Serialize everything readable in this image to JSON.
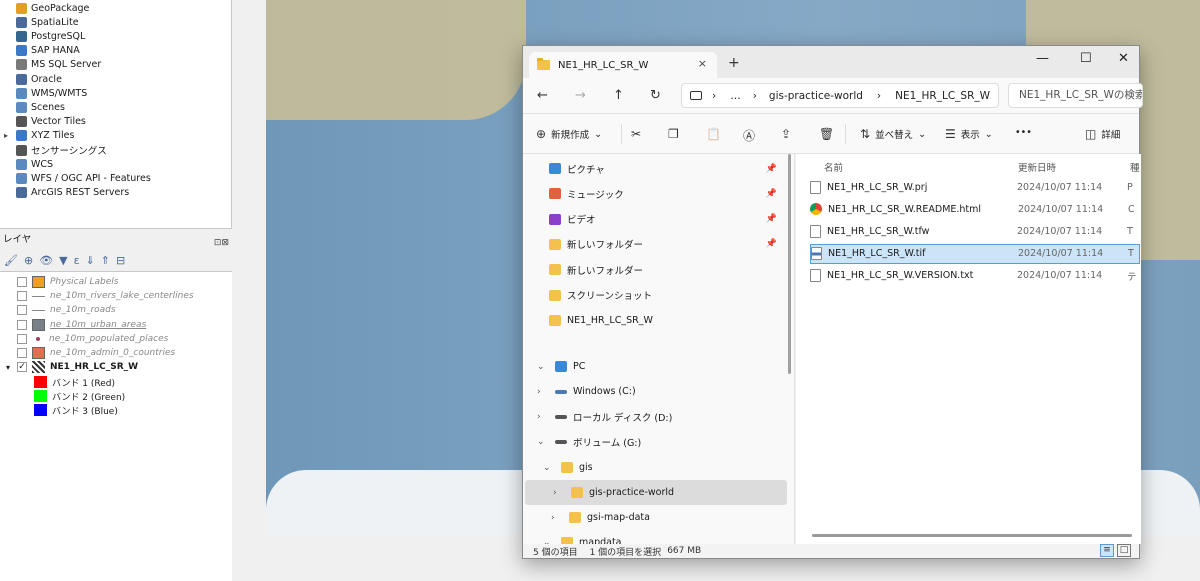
{
  "browser": {
    "items": [
      {
        "label": "GeoPackage",
        "icon": "geopackage-icon",
        "color": "#e0a020"
      },
      {
        "label": "SpatiaLite",
        "icon": "feather-icon",
        "color": "#4a6a9a"
      },
      {
        "label": "PostgreSQL",
        "icon": "elephant-icon",
        "color": "#336791"
      },
      {
        "label": "SAP HANA",
        "icon": "grid-icon",
        "color": "#3a78c8"
      },
      {
        "label": "MS SQL Server",
        "icon": "mssql-icon",
        "color": "#7a7a7a"
      },
      {
        "label": "Oracle",
        "icon": "oracle-icon",
        "color": "#4a6a9a"
      },
      {
        "label": "WMS/WMTS",
        "icon": "globe-icon",
        "color": "#5a8ac0"
      },
      {
        "label": "Scenes",
        "icon": "globe-icon",
        "color": "#5a8ac0"
      },
      {
        "label": "Vector Tiles",
        "icon": "tiles-icon",
        "color": "#555555"
      },
      {
        "label": "XYZ Tiles",
        "icon": "tiles-icon",
        "color": "#3a78c8"
      },
      {
        "label": "センサーシングス",
        "icon": "sensor-icon",
        "color": "#555555"
      },
      {
        "label": "WCS",
        "icon": "globe-icon",
        "color": "#5a8ac0"
      },
      {
        "label": "WFS / OGC API - Features",
        "icon": "globe-icon",
        "color": "#5a8ac0"
      },
      {
        "label": "ArcGIS REST Servers",
        "icon": "arcgis-icon",
        "color": "#4a6a9a"
      }
    ]
  },
  "layers_panel": {
    "title": "レイヤ",
    "buttons": "⊡⊠"
  },
  "layers": [
    {
      "name": "Physical Labels",
      "checked": "",
      "sym_color": "#f0a020",
      "style": "italic"
    },
    {
      "name": "ne_10m_rivers_lake_centerlines",
      "checked": "",
      "sym_color": "#888888",
      "style": "italic"
    },
    {
      "name": "ne_10m_roads",
      "checked": "",
      "sym_color": "#888888",
      "style": "italic"
    },
    {
      "name": "ne_10m_urban_areas",
      "checked": "",
      "sym_color": "#7a8088",
      "style": "italic"
    },
    {
      "name": "ne_10m_populated_places",
      "checked": "",
      "sym_color": "#a04060",
      "style": "italic"
    },
    {
      "name": "ne_10m_admin_0_countries",
      "checked": "",
      "sym_color": "#e07050",
      "style": "italic"
    },
    {
      "name": "NE1_HR_LC_SR_W",
      "checked": "✓",
      "sym_color": "#333333",
      "style": "bold"
    }
  ],
  "bands": [
    {
      "label": "バンド 1 (Red)",
      "color": "#ff0000"
    },
    {
      "label": "バンド 2 (Green)",
      "color": "#00ff00"
    },
    {
      "label": "バンド 3 (Blue)",
      "color": "#0000ff"
    }
  ],
  "explorer": {
    "tab_title": "NE1_HR_LC_SR_W",
    "tab_close": "×",
    "new_tab": "+",
    "window_buttons": [
      "—",
      "☐",
      "✕"
    ],
    "nav": {
      "back": "←",
      "forward": "→",
      "up": "↑",
      "refresh": "↻"
    },
    "address": {
      "more": "…",
      "segments": [
        "gis-practice-world",
        "NE1_HR_LC_SR_W"
      ]
    },
    "search_placeholder": "NE1_HR_LC_SR_Wの検索",
    "commands": {
      "new": "新規作成",
      "sort": "並べ替え",
      "view": "表示",
      "more": "•••",
      "details": "詳細"
    },
    "nav_pane": [
      {
        "label": "ピクチャ",
        "icon": "pictures-icon",
        "color": "#3a88d8",
        "pinned": true
      },
      {
        "label": "ミュージック",
        "icon": "music-icon",
        "color": "#e06040",
        "pinned": true
      },
      {
        "label": "ビデオ",
        "icon": "video-icon",
        "color": "#8a40c8",
        "pinned": true
      },
      {
        "label": "新しいフォルダー",
        "icon": "folder-icon",
        "color": "#f3c24c",
        "pinned": true
      },
      {
        "label": "新しいフォルダー",
        "icon": "folder-icon",
        "color": "#f3c24c",
        "pinned": false
      },
      {
        "label": "スクリーンショット",
        "icon": "folder-icon",
        "color": "#f3c24c",
        "pinned": false
      },
      {
        "label": "NE1_HR_LC_SR_W",
        "icon": "folder-icon",
        "color": "#f3c24c",
        "pinned": false
      }
    ],
    "tree": [
      {
        "label": "PC",
        "chev": "⌄",
        "icon": "pc-icon",
        "color": "#3a88d8"
      },
      {
        "label": "Windows (C:)",
        "chev": "›",
        "icon": "drive-icon",
        "color": "#4a78b0"
      },
      {
        "label": "ローカル ディスク (D:)",
        "chev": "›",
        "icon": "drive-icon",
        "color": "#555555"
      },
      {
        "label": "ボリューム (G:)",
        "chev": "⌄",
        "icon": "drive-icon",
        "color": "#555555"
      },
      {
        "label": "gis",
        "chev": "⌄",
        "icon": "folder-icon",
        "color": "#f3c24c"
      },
      {
        "label": "gis-practice-world",
        "chev": "›",
        "icon": "folder-icon",
        "color": "#f3c24c",
        "selected": true
      },
      {
        "label": "gsi-map-data",
        "chev": "›",
        "icon": "folder-icon",
        "color": "#f3c24c"
      },
      {
        "label": "mapdata",
        "chev": "⌄",
        "icon": "folder-icon",
        "color": "#f3c24c"
      }
    ],
    "columns": {
      "name": "名前",
      "date": "更新日時",
      "type": "種"
    },
    "files": [
      {
        "name": "NE1_HR_LC_SR_W.prj",
        "date": "2024/10/07 11:14",
        "type": "P",
        "icon": "file-icon"
      },
      {
        "name": "NE1_HR_LC_SR_W.README.html",
        "date": "2024/10/07 11:14",
        "type": "C",
        "icon": "chrome-icon"
      },
      {
        "name": "NE1_HR_LC_SR_W.tfw",
        "date": "2024/10/07 11:14",
        "type": "T",
        "icon": "file-icon"
      },
      {
        "name": "NE1_HR_LC_SR_W.tif",
        "date": "2024/10/07 11:14",
        "type": "T",
        "icon": "image-file-icon",
        "selected": true
      },
      {
        "name": "NE1_HR_LC_SR_W.VERSION.txt",
        "date": "2024/10/07 11:14",
        "type": "テ",
        "icon": "file-icon"
      }
    ],
    "status": {
      "count": "5 個の項目",
      "selection": "1 個の項目を選択",
      "size": "667 MB"
    }
  }
}
